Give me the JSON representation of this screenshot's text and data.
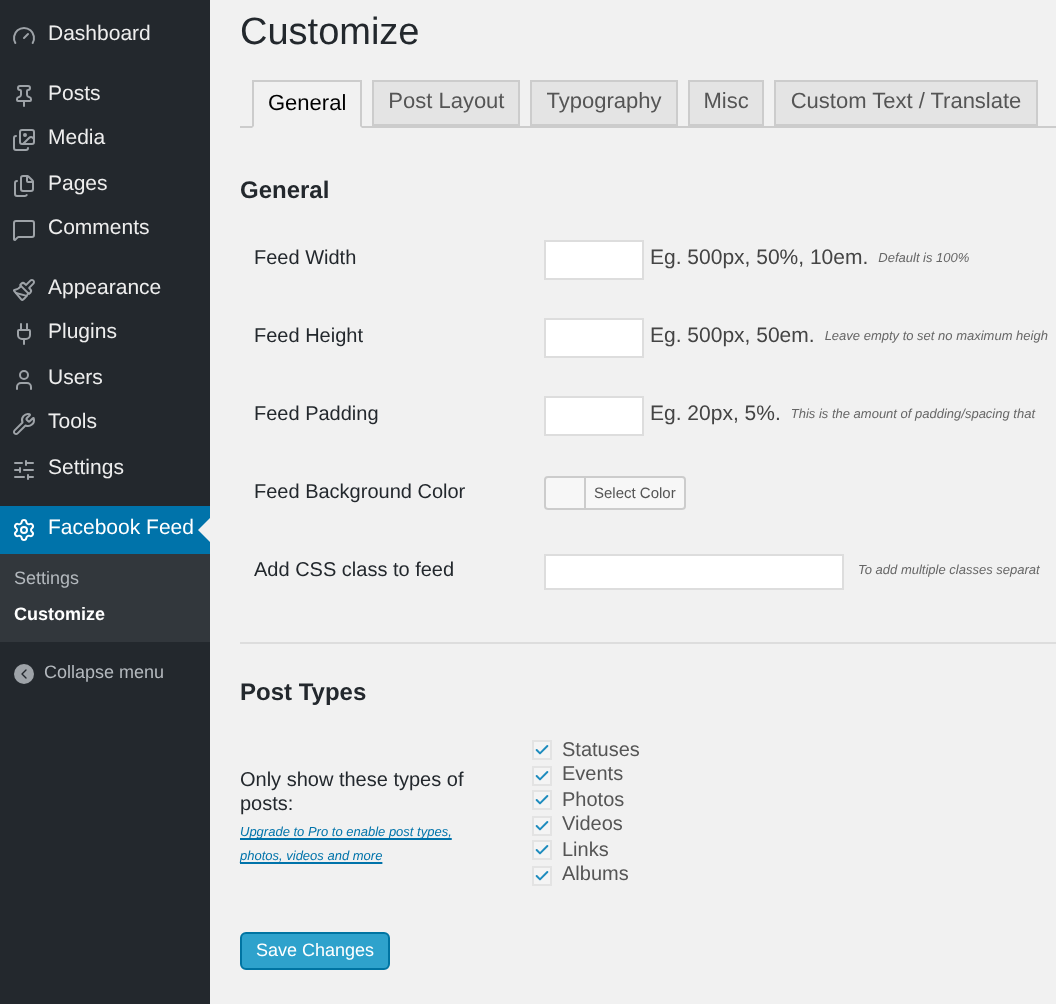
{
  "sidebar": {
    "groups": [
      [
        {
          "label": "Dashboard",
          "selected": false
        }
      ],
      [
        {
          "label": "Posts",
          "selected": false
        },
        {
          "label": "Media",
          "selected": false
        },
        {
          "label": "Pages",
          "selected": false
        },
        {
          "label": "Comments",
          "selected": false
        }
      ],
      [
        {
          "label": "Appearance",
          "selected": false
        },
        {
          "label": "Plugins",
          "selected": false
        },
        {
          "label": "Users",
          "selected": false
        },
        {
          "label": "Tools",
          "selected": false
        },
        {
          "label": "Settings",
          "selected": false
        }
      ],
      [
        {
          "label": "Facebook Feed",
          "selected": true,
          "children": [
            {
              "label": "Settings",
              "selected": false
            },
            {
              "label": "Customize",
              "selected": true
            }
          ]
        }
      ]
    ],
    "collapse": "Collapse menu"
  },
  "page_title": "Customize",
  "tabs": [
    {
      "label": "General",
      "selected": true
    },
    {
      "label": "Post Layout",
      "selected": false
    },
    {
      "label": "Typography",
      "selected": false
    },
    {
      "label": "Misc",
      "selected": false
    },
    {
      "label": "Custom Text / Translate",
      "selected": false
    }
  ],
  "general": {
    "heading": "General",
    "fields": [
      {
        "kind": "text",
        "label": "Feed Width",
        "example": "Eg. 500px, 50%, 10em.",
        "hint": "Default is 100%"
      },
      {
        "kind": "text",
        "label": "Feed Height",
        "example": "Eg. 500px, 50em.",
        "hint": "Leave empty to set no maximum heigh"
      },
      {
        "kind": "text",
        "label": "Feed Padding",
        "example": "Eg. 20px, 5%.",
        "hint": "This is the amount of padding/spacing that"
      },
      {
        "kind": "color",
        "label": "Feed Background Color",
        "button": "Select Color"
      },
      {
        "kind": "wide",
        "label": "Add CSS class to feed",
        "hint": "To add multiple classes separat"
      }
    ]
  },
  "post_types": {
    "heading": "Post Types",
    "label": "Only show these types of posts:",
    "link": "Upgrade to Pro to enable post types, photos, videos and more",
    "options": [
      {
        "label": "Statuses",
        "checked": true
      },
      {
        "label": "Events",
        "checked": true
      },
      {
        "label": "Photos",
        "checked": true
      },
      {
        "label": "Videos",
        "checked": true
      },
      {
        "label": "Links",
        "checked": true
      },
      {
        "label": "Albums",
        "checked": true
      }
    ]
  },
  "save_button": "Save Changes"
}
